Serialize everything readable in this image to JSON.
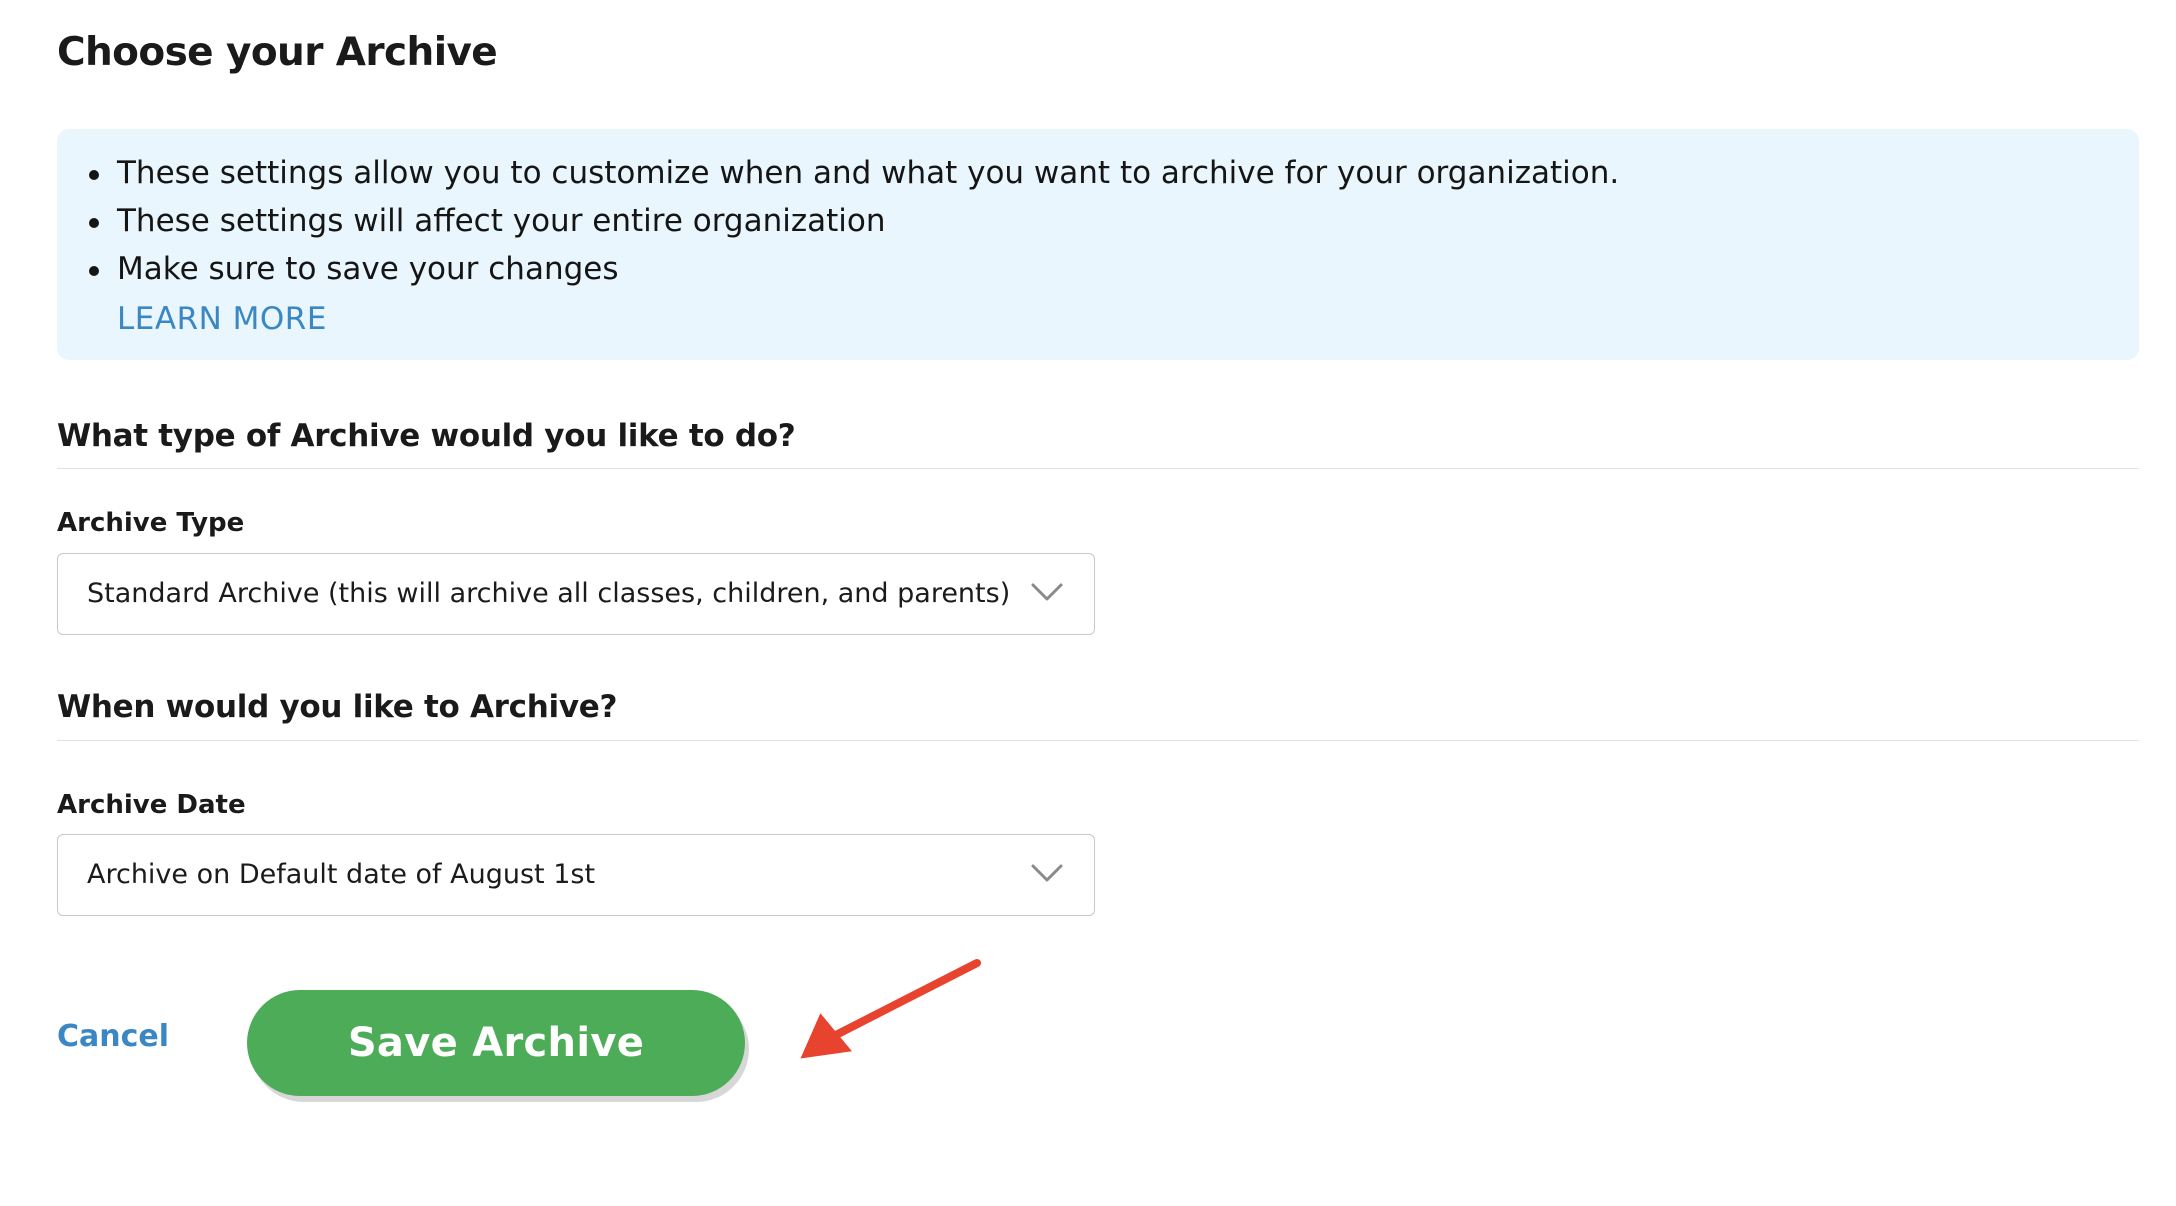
{
  "page": {
    "title": "Choose your Archive"
  },
  "info": {
    "items": [
      "These settings allow you to customize when and what you want to archive for your organization.",
      "These settings will affect your entire organization",
      "Make sure to save your changes"
    ],
    "learn_more": "LEARN MORE"
  },
  "type_section": {
    "heading": "What type of Archive would you like to do?",
    "label": "Archive Type",
    "selected": "Standard Archive (this will archive all classes, children, and parents)"
  },
  "date_section": {
    "heading": "When would you like to Archive?",
    "label": "Archive Date",
    "selected": "Archive on Default date of August 1st"
  },
  "actions": {
    "cancel_label": "Cancel",
    "save_label": "Save Archive"
  },
  "icons": {
    "dropdown": "chevron-down-icon",
    "annotation": "red-arrow-icon"
  },
  "colors": {
    "info_background": "#e9f6fd",
    "link": "#3a87c4",
    "save_button": "#4cac57",
    "annotation_arrow": "#e8432e"
  }
}
